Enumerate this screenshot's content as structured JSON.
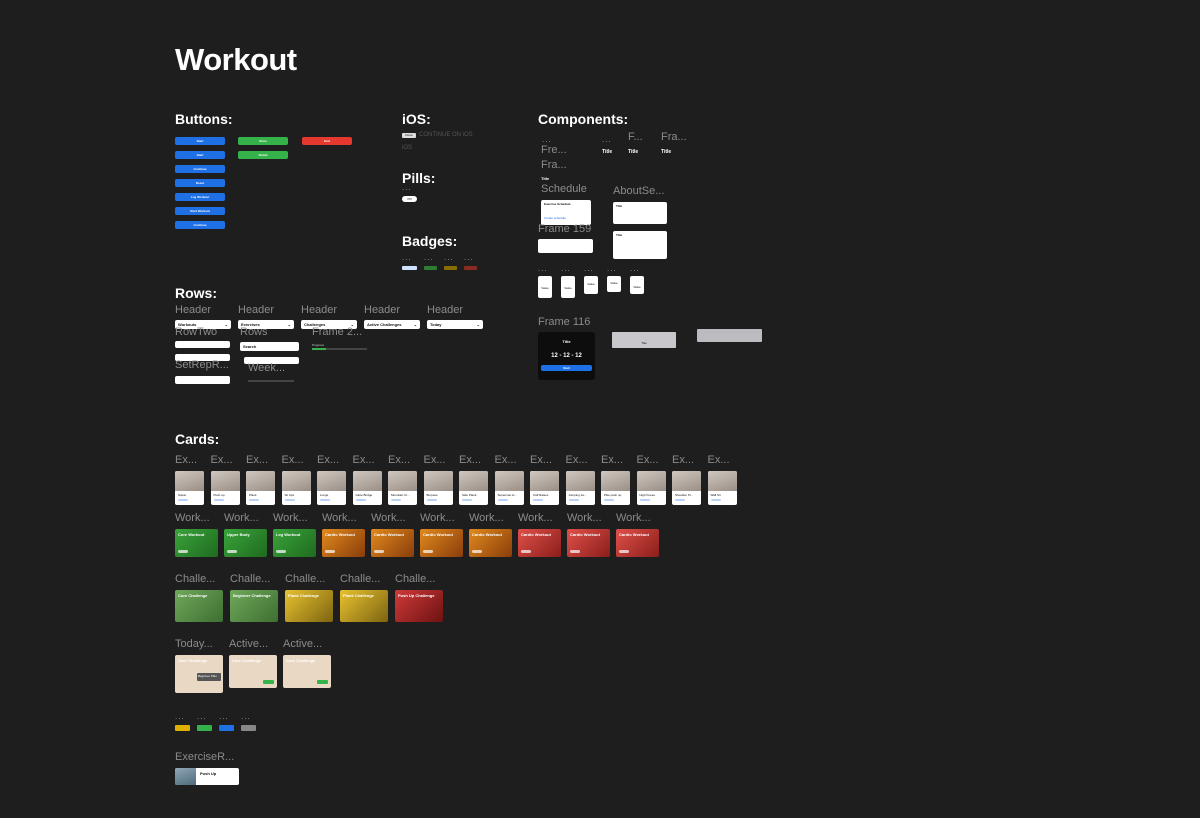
{
  "page": {
    "title": "Workout"
  },
  "sections": {
    "buttons": "Buttons:",
    "ios": "iOS:",
    "pills": "Pills:",
    "badges": "Badges:",
    "components": "Components:",
    "rows": "Rows:",
    "cards": "Cards:"
  },
  "buttons": {
    "col1": [
      "Start",
      "Start",
      "Continue",
      "Reset",
      "Log Workout",
      "Start Workout",
      "Continue"
    ],
    "col2": [
      "Done",
      "Finish"
    ],
    "col3": [
      "End"
    ]
  },
  "ios": {
    "tag": "Done",
    "text1": "CONTINUE ON iOS",
    "text2": "iOS"
  },
  "pills": {
    "dots": "...",
    "pill_label": "Pill"
  },
  "badges": {
    "dots": [
      "...",
      "...",
      "...",
      "..."
    ],
    "labels": [
      "",
      "",
      "",
      ""
    ]
  },
  "badge_colors": [
    "#cfe2ff",
    "#35b34a",
    "#d9a400",
    "#e5392f"
  ],
  "components": {
    "top_labels": [
      "...",
      "...",
      "F...",
      "Fra..."
    ],
    "fre": "Fre...",
    "fra": "Fra...",
    "title": "Title",
    "schedule": "Schedule",
    "about": "AboutSe...",
    "frame159": "Frame 159",
    "frame116": "Frame 116",
    "exercise_schedule": "Exercise Schedule",
    "create_schedule": "Create schedule",
    "value": "Value",
    "date": "12 - 12 - 12",
    "start": "Start",
    "small_dots": [
      "...",
      "...",
      "...",
      "...",
      "..."
    ]
  },
  "rows": {
    "headers": [
      "Header",
      "Header",
      "Header",
      "Header",
      "Header"
    ],
    "header_rows": [
      "Workouts",
      "Exercises",
      "Challenges",
      "Active Challenges",
      "Today"
    ],
    "row_two": "RowTwo",
    "rows_lbl": "Rows",
    "frame2": "Frame 2...",
    "set_rep": "SetRepR...",
    "week": "Week...",
    "search": "Search",
    "progress": "Progress"
  },
  "cards": {
    "exercise_label": "Ex...",
    "exercises": [
      "Squat",
      "Push up",
      "Plank",
      "Sit Ups",
      "Lunge",
      "Glute Bridge",
      "Mountain Cl...",
      "Burpees",
      "Side Plank",
      "Superman H...",
      "Calf Raises",
      "Jumping Ja...",
      "Pike push up",
      "High Knees",
      "Shoulder Pr...",
      "Wall Sit"
    ],
    "workout_label": "Work...",
    "workouts": [
      "Core Workout",
      "Upper Body",
      "Leg Workout",
      "Cardio Workout",
      "Cardio Workout",
      "Cardio Workout",
      "Cardio Workout",
      "Cardio Workout",
      "Cardio Workout",
      "Cardio Workout"
    ],
    "challenge_label": "Challe...",
    "challenges": [
      "Core Challenge",
      "Beginner Challenge",
      "Plank Challenge",
      "Plank Challenge",
      "Push Up Challenge"
    ],
    "today_label": "Today...",
    "active_label": "Active...",
    "today_cards": [
      "Core Challenge",
      "Core Challenge",
      "Core Challenge"
    ],
    "beginner_plan": "Beginner Plan",
    "small_dots": [
      "...",
      "...",
      "...",
      "..."
    ],
    "exercise_row_label": "ExerciseR...",
    "exercise_row_title": "Push Up"
  },
  "colors": {
    "background": "#1e1e1e",
    "blue": "#1f6fe5",
    "green": "#35b34a",
    "red": "#e5392f"
  }
}
